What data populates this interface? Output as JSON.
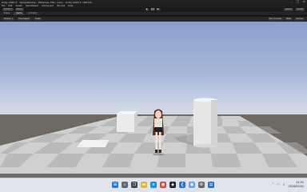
{
  "window": {
    "title": "Unity 2022.3 - SampleScene - Windows, Mac, Linux - Unity 2022.3 <DX11>"
  },
  "menu": {
    "items": [
      "File",
      "Edit",
      "Assets",
      "GameObject",
      "Component",
      "Window",
      "Help"
    ]
  },
  "toolbar": {
    "account": "Account",
    "cloud": "Cloud",
    "play_icon": "play-icon",
    "pause_icon": "pause-icon",
    "step_icon": "step-icon",
    "layers": "Layers",
    "layout": "Layout"
  },
  "tabs": {
    "scene": "Scene",
    "game": "Game",
    "animator": "Animator"
  },
  "view_tools": {
    "display": "Display 1",
    "aspect": "Free Aspect",
    "scale": "Scale",
    "play_focused": "Play Focused",
    "stats": "Stats",
    "gizmos": "Gizmos"
  },
  "taskbar": {
    "icons": [
      "windows-start-icon",
      "search-icon",
      "task-view-icon",
      "file-explorer-icon",
      "edge-icon",
      "chrome-icon",
      "unity-icon",
      "vscode-icon",
      "photos-icon",
      "settings-icon",
      "store-icon"
    ],
    "time": "11:52",
    "date": "2024/01/01"
  },
  "colors": {
    "sky_top": "#8c9fcc",
    "sky_horizon": "#dcdde0",
    "ground": "#6f6964",
    "checker_light": "#d6d6d6",
    "checker_dark": "#b8b8b8"
  }
}
